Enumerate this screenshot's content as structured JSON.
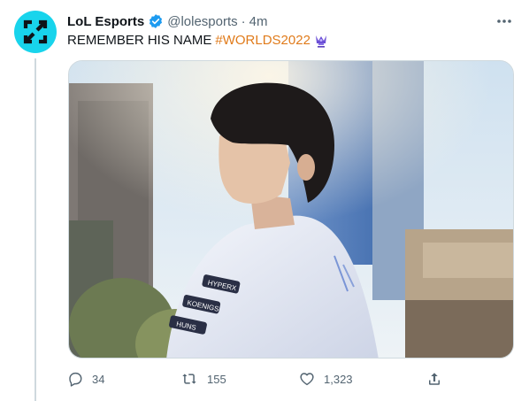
{
  "tweet": {
    "author_name": "LoL Esports",
    "handle": "@lolesports",
    "separator": "·",
    "time": "4m",
    "text": "REMEMBER HIS NAME",
    "hashtag": "#WORLDS2022",
    "icons": {
      "avatar": "lol-esports-logo-icon",
      "verified": "verified-badge-icon",
      "more": "more-options-icon",
      "trophy": "worlds-trophy-icon"
    },
    "media": {
      "jersey_sponsors": [
        "HYPERX",
        "KOENIGS",
        "HUNS"
      ]
    }
  },
  "actions": {
    "reply_count": "34",
    "retweet_count": "155",
    "like_count": "1,323"
  },
  "colors": {
    "avatar_bg": "#18d4ec",
    "verified": "#1d9bf0",
    "hashtag": "#e07b1b",
    "muted": "#536471"
  }
}
